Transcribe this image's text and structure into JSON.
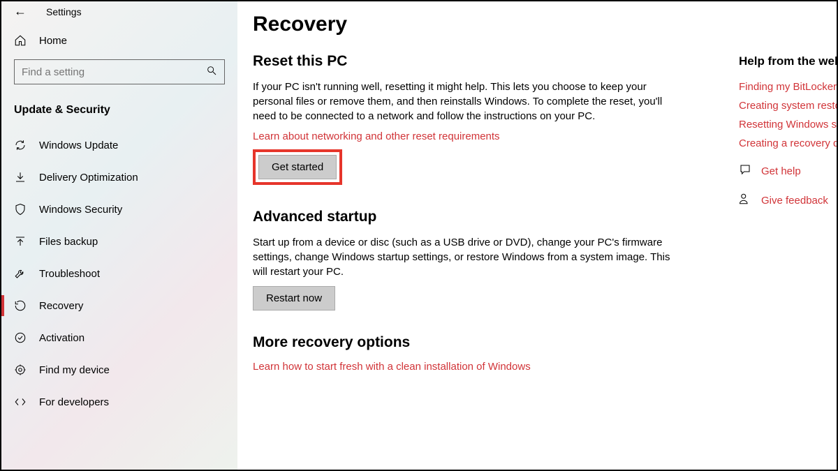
{
  "header": {
    "title": "Settings"
  },
  "sidebar": {
    "home": "Home",
    "search_placeholder": "Find a setting",
    "section_title": "Update & Security",
    "items": [
      {
        "label": "Windows Update"
      },
      {
        "label": "Delivery Optimization"
      },
      {
        "label": "Windows Security"
      },
      {
        "label": "Files backup"
      },
      {
        "label": "Troubleshoot"
      },
      {
        "label": "Recovery"
      },
      {
        "label": "Activation"
      },
      {
        "label": "Find my device"
      },
      {
        "label": "For developers"
      }
    ]
  },
  "main": {
    "title": "Recovery",
    "reset": {
      "heading": "Reset this PC",
      "body": "If your PC isn't running well, resetting it might help. This lets you choose to keep your personal files or remove them, and then reinstalls Windows. To complete the reset, you'll need to be connected to a network and follow the instructions on your PC.",
      "link": "Learn about networking and other reset requirements",
      "button": "Get started"
    },
    "advanced": {
      "heading": "Advanced startup",
      "body": "Start up from a device or disc (such as a USB drive or DVD), change your PC's firmware settings, change Windows startup settings, or restore Windows from a system image. This will restart your PC.",
      "button": "Restart now"
    },
    "more": {
      "heading": "More recovery options",
      "link": "Learn how to start fresh with a clean installation of Windows"
    }
  },
  "right": {
    "title": "Help from the web",
    "links": [
      "Finding my BitLocker",
      "Creating system restore",
      "Resetting Windows s",
      "Creating a recovery d"
    ],
    "help": "Get help",
    "feedback": "Give feedback"
  }
}
